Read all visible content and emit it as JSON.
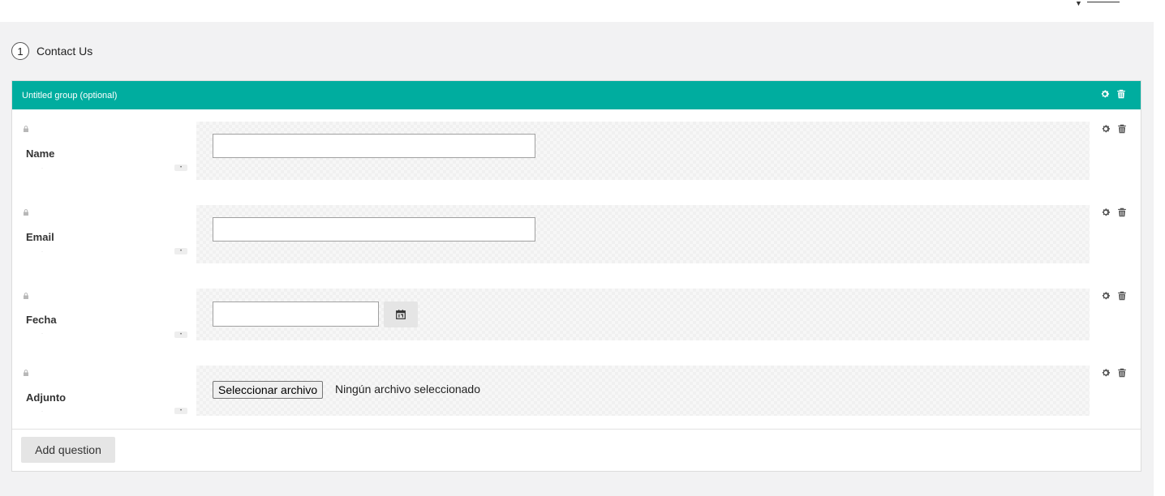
{
  "survey": {
    "step_number": "1",
    "step_title": "Contact Us"
  },
  "group": {
    "title": "Untitled group (optional)"
  },
  "questions": [
    {
      "label": "Name",
      "type": "text",
      "value": ""
    },
    {
      "label": "Email",
      "type": "text",
      "value": ""
    },
    {
      "label": "Fecha",
      "type": "date",
      "value": ""
    },
    {
      "label": "Adjunto",
      "type": "file",
      "button_label": "Seleccionar archivo",
      "status": "Ningún archivo seleccionado"
    }
  ],
  "add_question_label": "Add question",
  "colors": {
    "group_header": "#00ad9f",
    "canvas": "#f2f2f3",
    "icon": "#555555",
    "lock": "#b8b8b8"
  },
  "icons": [
    "gear-icon",
    "trash-icon",
    "lock-icon",
    "calendar-icon"
  ]
}
